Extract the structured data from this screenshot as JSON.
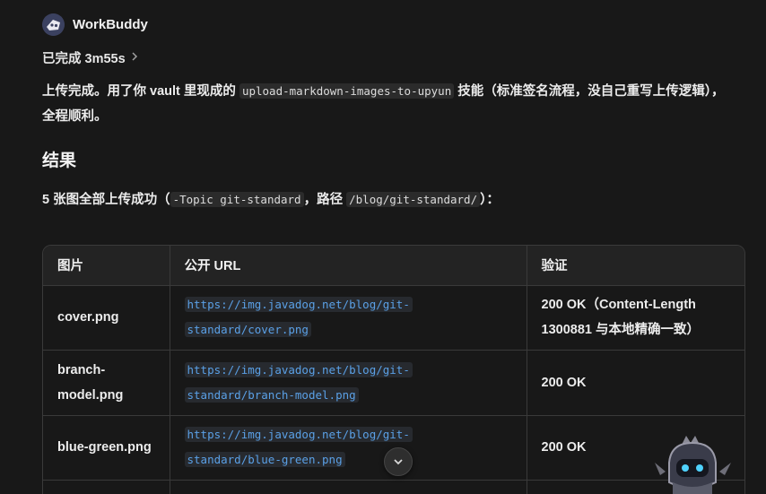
{
  "app": {
    "name": "WorkBuddy"
  },
  "status": {
    "text": "已完成 3m55s",
    "chevron": "chevron-right-icon"
  },
  "intro": {
    "before": "上传完成。用了你 vault 里现成的 ",
    "code": "upload-markdown-images-to-upyun",
    "after": " 技能（标准签名流程，没自己重写上传逻辑），全程顺利。"
  },
  "result": {
    "heading": "结果",
    "summary_before": "5 张图全部上传成功（",
    "summary_code1": "-Topic git-standard",
    "summary_mid": "，路径 ",
    "summary_code2": "/blog/git-standard/",
    "summary_after": "）："
  },
  "table": {
    "headers": [
      "图片",
      "公开 URL",
      "验证"
    ],
    "rows": [
      {
        "image": "cover.png",
        "url_line1": "https://img.javadog.net/blog/git-",
        "url_line2": "standard/cover.png",
        "verify": "200 OK（Content-Length 1300881 与本地精确一致）"
      },
      {
        "image": "branch-model.png",
        "url_line1": "https://img.javadog.net/blog/git-",
        "url_line2": "standard/branch-model.png",
        "verify": "200 OK"
      },
      {
        "image": "blue-green.png",
        "url_line1": "https://img.javadog.net/blog/git-",
        "url_line2": "standard/blue-green.png",
        "verify": "200 OK"
      }
    ]
  },
  "icons": {
    "scroll_down": "chevron-down-icon",
    "mascot": "robot-mascot-icon",
    "avatar": "workbuddy-logo-icon"
  }
}
